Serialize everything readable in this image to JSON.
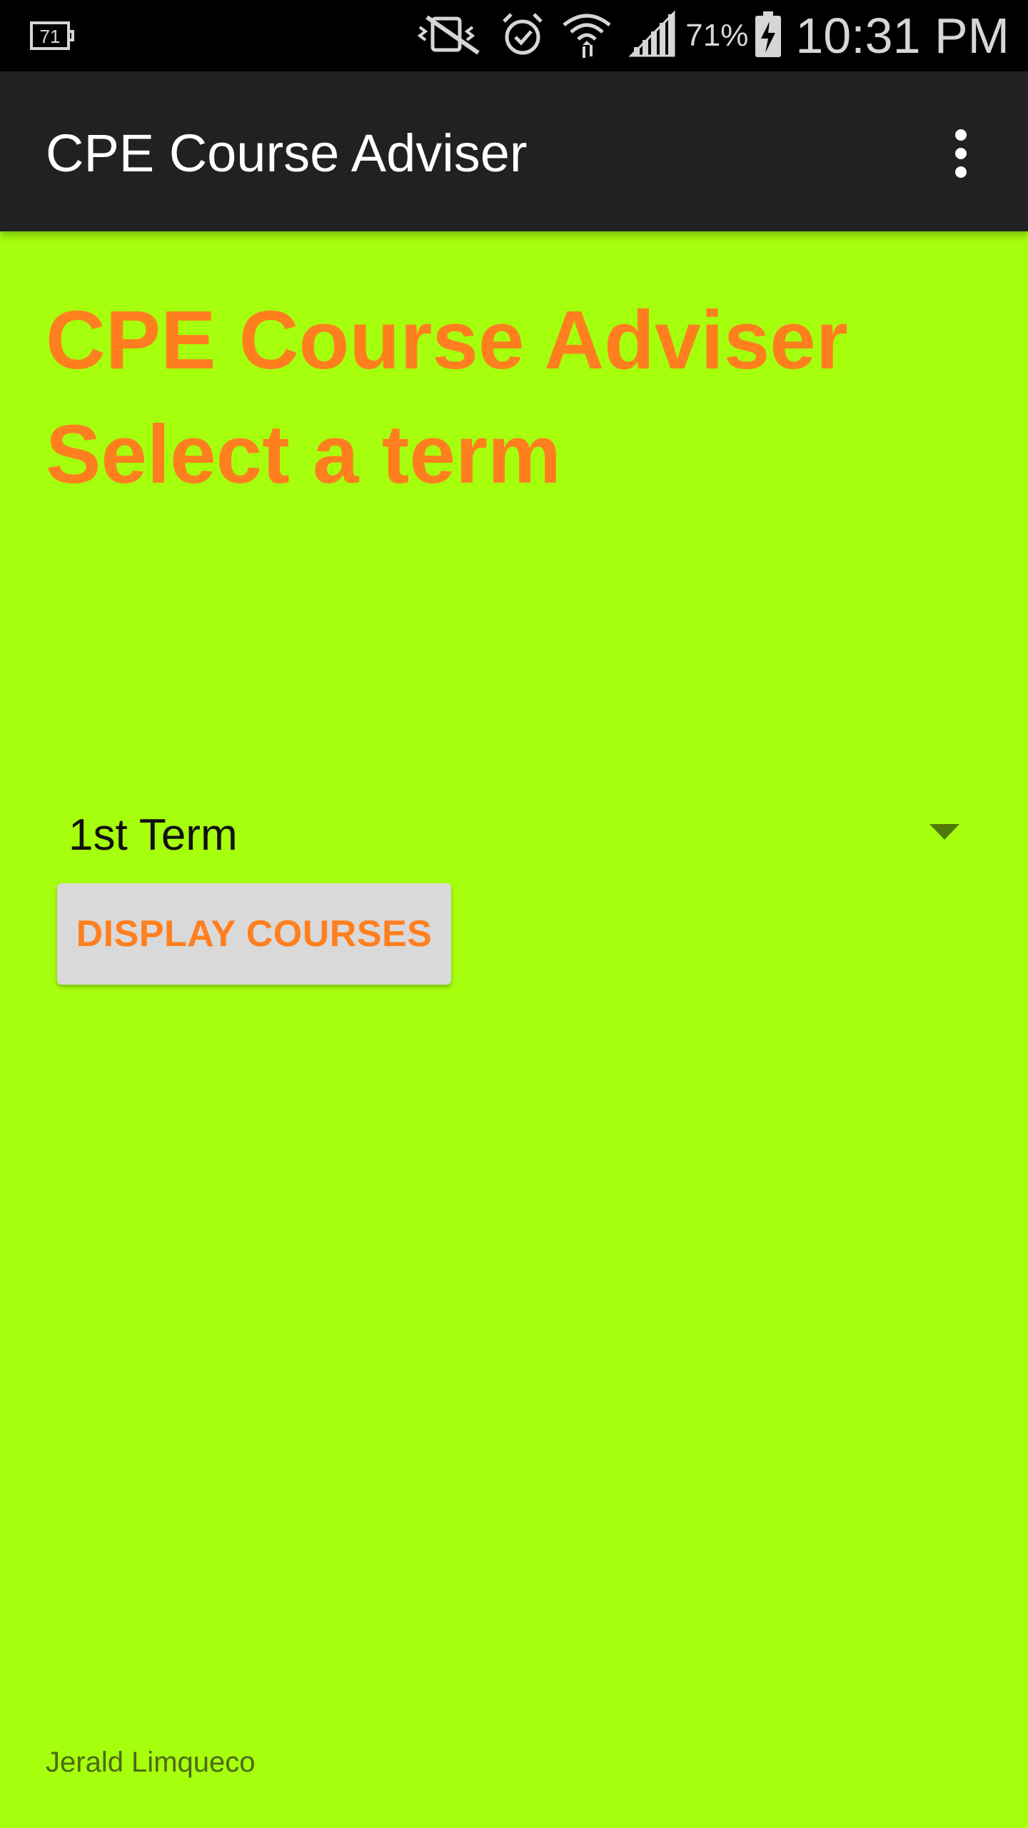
{
  "status_bar": {
    "notification_badge": "71",
    "battery_percent": "71%",
    "time": "10:31 PM",
    "icons": [
      "notification-badge-icon",
      "vibrate-off-icon",
      "alarm-icon",
      "wifi-icon",
      "signal-icon",
      "battery-charging-icon"
    ]
  },
  "app_bar": {
    "title": "CPE Course Adviser",
    "menu_icon": "overflow-menu-icon"
  },
  "main": {
    "heading_line1": "CPE Course Adviser",
    "heading_line2": "Select a term",
    "term_spinner": {
      "selected": "1st Term"
    },
    "display_button_label": "DISPLAY COURSES"
  },
  "footer": {
    "author": "Jerald Limqueco"
  },
  "colors": {
    "background": "#a6ff0d",
    "accent_orange": "#ff7f1f",
    "app_bar": "#212121",
    "status_bar": "#000000",
    "button_bg": "#d9d9d9"
  }
}
